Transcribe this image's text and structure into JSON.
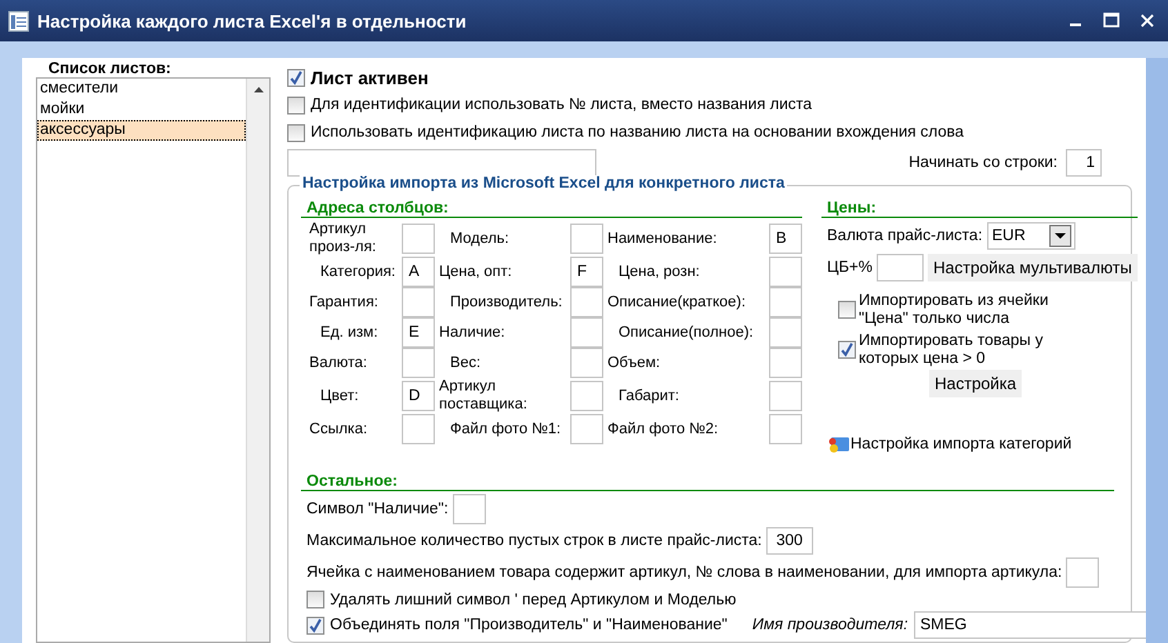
{
  "window": {
    "title": "Настройка каждого листа Excel'я в отдельности"
  },
  "sheet_list": {
    "title": "Список листов:",
    "items": [
      {
        "label": "смесители",
        "selected": false
      },
      {
        "label": "мойки",
        "selected": false
      },
      {
        "label": "аксессуары",
        "selected": true
      }
    ]
  },
  "sheet_options": [
    {
      "label": "Лист активен",
      "checked": true,
      "kind": "primary"
    },
    {
      "label": "Для идентификации использовать № листа, вместо названия листа",
      "checked": false,
      "kind": "normal"
    },
    {
      "label": "Использовать идентификацию листа по названию листа на основании вхождения слова",
      "checked": false,
      "kind": "normal"
    }
  ],
  "start_row": {
    "label": "Начинать со строки:",
    "value": "1"
  },
  "import_group": {
    "title": "Настройка импорта из Microsoft Excel для конкретного листа",
    "columns": {
      "title": "Адреса столбцов:",
      "fields": [
        {
          "label": "Артикул произ-ля:"
        },
        {
          "label": "Модель:"
        },
        {
          "label": "Наименование:",
          "value": "B"
        },
        {
          "label": "Категория:",
          "value": "A"
        },
        {
          "label": "Цена, опт:",
          "value": "F"
        },
        {
          "label": "Цена, розн:"
        },
        {
          "label": "Гарантия:"
        },
        {
          "label": "Производитель:"
        },
        {
          "label": "Описание(краткое):"
        },
        {
          "label": "Ед. изм:",
          "value": "E"
        },
        {
          "label": "Наличие:"
        },
        {
          "label": "Описание(полное):"
        },
        {
          "label": "Валюта:"
        },
        {
          "label": "Вес:"
        },
        {
          "label": "Объем:"
        },
        {
          "label": "Цвет:",
          "value": "D"
        },
        {
          "label": "Артикул поставщика:"
        },
        {
          "label": "Габарит:"
        },
        {
          "label": "Ссылка:"
        },
        {
          "label": "Файл фото №1:"
        },
        {
          "label": "Файл фото №2:"
        }
      ]
    },
    "prices": {
      "title": "Цены:",
      "currency": {
        "label": "Валюта прайс-листа:",
        "value": "EUR"
      },
      "cb_percent": {
        "label": "ЦБ+%"
      },
      "multicurrency_button": "Настройка мультивалюты",
      "checkboxes": [
        {
          "label": "Импортировать из ячейки \"Цена\" только числа",
          "checked": false
        },
        {
          "label": "Импортировать товары у которых цена > 0",
          "checked": true
        }
      ],
      "settings_button": "Настройка",
      "categories_link": "Настройка импорта категорий"
    },
    "other": {
      "title": "Остальное:",
      "availability_symbol": {
        "label": "Символ \"Наличие\":"
      },
      "max_empty_rows": {
        "label": "Максимальное количество пустых строк в листе прайс-листа:",
        "value": "300"
      },
      "article_word": {
        "label": "Ячейка с наименованием товара содержит артикул, № слова в наименовании, для импорта артикула:"
      },
      "checkboxes": [
        {
          "label": "Удалять лишний символ ' перед Артикулом и Моделью",
          "checked": false
        },
        {
          "label": "Объединять поля \"Производитель\" и \"Наименование\"",
          "checked": true
        }
      ],
      "manufacturer": {
        "label": "Имя производителя:",
        "value": "SMEG"
      }
    }
  }
}
